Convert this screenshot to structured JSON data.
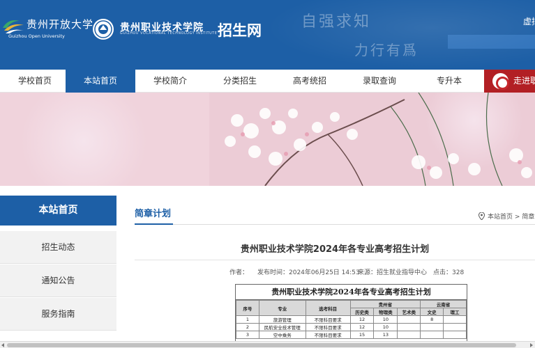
{
  "header": {
    "logo1_cn": "贵州开放大学",
    "logo1_en": "Guizhou Open University",
    "logo2_cn": "贵州职业技术学院",
    "logo2_en": "GUIZHOU VOCATIONAL TECHNOLOGY INSTITUTE",
    "site_tag": "招生网",
    "slogan_line1": "自强求知",
    "slogan_line2": "力行有爲",
    "top_link": "虚拟"
  },
  "nav": {
    "items": [
      "学校首页",
      "本站首页",
      "学校简介",
      "分类招生",
      "高考统招",
      "录取查询",
      "专升本"
    ],
    "active": "本站首页",
    "promo": "走进职"
  },
  "sidebar": {
    "head": "本站首页",
    "items": [
      "招生动态",
      "通知公告",
      "服务指南"
    ]
  },
  "content": {
    "section_title": "简章计划",
    "breadcrumb_home": "本站首页",
    "breadcrumb_sep": ">",
    "breadcrumb_current": "简章计划",
    "article_title": "贵州职业技术学院2024年各专业高考招生计划",
    "meta": {
      "author_label": "作者：",
      "published": "发布时间：2024年06月25日 14:53",
      "source": "来源：招生就业指导中心",
      "clicks": "点击：328"
    }
  },
  "plan_table": {
    "title": "贵州职业技术学院2024年各专业高考招生计划",
    "headers": {
      "no": "序号",
      "major": "专业",
      "subject": "选考科目",
      "guizhou": "贵州省",
      "yunnan": "云南省",
      "history": "历史类",
      "physics": "物理类",
      "arts": "艺术类",
      "liberal": "文史",
      "science": "理工"
    },
    "rows": [
      {
        "no": "1",
        "major": "旅游管理",
        "subject": "不限科目要求",
        "history": "12",
        "physics": "10",
        "arts": "",
        "liberal": "8",
        "science": ""
      },
      {
        "no": "2",
        "major": "民航安全技术管理",
        "subject": "不限科目要求",
        "history": "12",
        "physics": "10",
        "arts": "",
        "liberal": "",
        "science": ""
      },
      {
        "no": "3",
        "major": "空中乘务",
        "subject": "不限科目要求",
        "history": "15",
        "physics": "13",
        "arts": "",
        "liberal": "",
        "science": ""
      }
    ]
  }
}
